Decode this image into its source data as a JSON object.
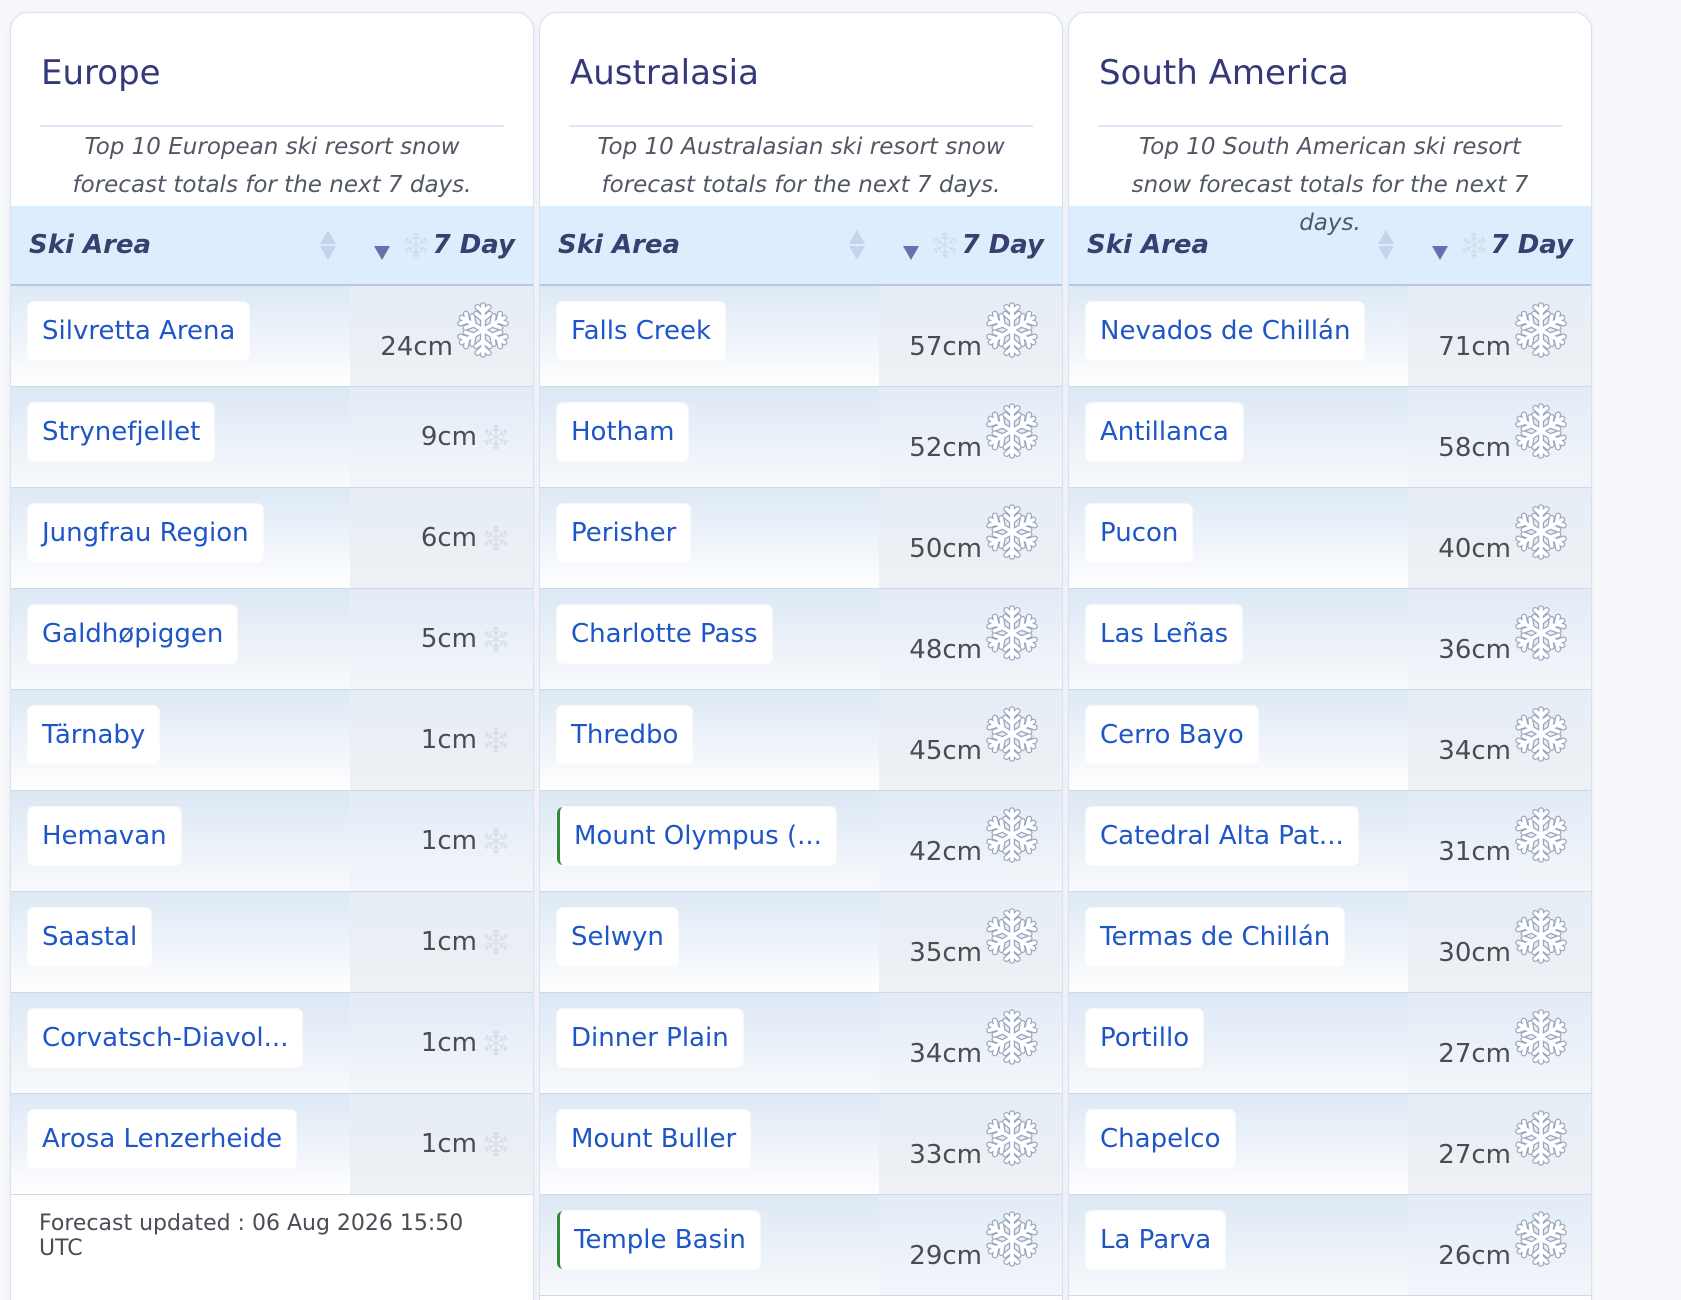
{
  "panels": [
    {
      "title": "Europe",
      "subtitle": "Top 10 European ski resort snow forecast totals for the next 7 days.",
      "col_area": "Ski Area",
      "col_7day": "7 Day",
      "rows": [
        {
          "name": "Silvretta Arena",
          "value": "24cm",
          "flake": "big"
        },
        {
          "name": "Strynefjellet",
          "value": "9cm",
          "flake": "small"
        },
        {
          "name": "Jungfrau Region",
          "value": "6cm",
          "flake": "small"
        },
        {
          "name": "Galdhøpiggen",
          "value": "5cm",
          "flake": "small"
        },
        {
          "name": "Tärnaby",
          "value": "1cm",
          "flake": "small"
        },
        {
          "name": "Hemavan",
          "value": "1cm",
          "flake": "small"
        },
        {
          "name": "Saastal",
          "value": "1cm",
          "flake": "small"
        },
        {
          "name": "Corvatsch-Diavol...",
          "value": "1cm",
          "flake": "small"
        },
        {
          "name": "Arosa Lenzerheide",
          "value": "1cm",
          "flake": "small"
        }
      ],
      "footer": "Forecast updated : 06 Aug 2026 15:50 UTC"
    },
    {
      "title": "Australasia",
      "subtitle": "Top 10 Australasian ski resort snow forecast totals for the next 7 days.",
      "col_area": "Ski Area",
      "col_7day": "7 Day",
      "rows": [
        {
          "name": "Falls Creek",
          "value": "57cm",
          "flake": "big"
        },
        {
          "name": "Hotham",
          "value": "52cm",
          "flake": "big"
        },
        {
          "name": "Perisher",
          "value": "50cm",
          "flake": "big"
        },
        {
          "name": "Charlotte Pass",
          "value": "48cm",
          "flake": "big"
        },
        {
          "name": "Thredbo",
          "value": "45cm",
          "flake": "big"
        },
        {
          "name": "Mount Olympus (...",
          "value": "42cm",
          "flake": "big",
          "marked": true
        },
        {
          "name": "Selwyn",
          "value": "35cm",
          "flake": "big"
        },
        {
          "name": "Dinner Plain",
          "value": "34cm",
          "flake": "big"
        },
        {
          "name": "Mount Buller",
          "value": "33cm",
          "flake": "big"
        },
        {
          "name": "Temple Basin",
          "value": "29cm",
          "flake": "big",
          "marked": true
        }
      ],
      "footer": ""
    },
    {
      "title": "South America",
      "subtitle": "Top 10 South American ski resort snow forecast totals for the next 7 days.",
      "col_area": "Ski Area",
      "col_7day": "7 Day",
      "rows": [
        {
          "name": "Nevados de Chillán",
          "value": "71cm",
          "flake": "big"
        },
        {
          "name": "Antillanca",
          "value": "58cm",
          "flake": "big"
        },
        {
          "name": "Pucon",
          "value": "40cm",
          "flake": "big"
        },
        {
          "name": "Las Leñas",
          "value": "36cm",
          "flake": "big"
        },
        {
          "name": "Cerro Bayo",
          "value": "34cm",
          "flake": "big"
        },
        {
          "name": "Catedral Alta Pat...",
          "value": "31cm",
          "flake": "big"
        },
        {
          "name": "Termas de Chillán",
          "value": "30cm",
          "flake": "big"
        },
        {
          "name": "Portillo",
          "value": "27cm",
          "flake": "big"
        },
        {
          "name": "Chapelco",
          "value": "27cm",
          "flake": "big"
        },
        {
          "name": "La Parva",
          "value": "26cm",
          "flake": "big"
        }
      ],
      "footer": ""
    }
  ],
  "icons": {
    "snowflake": "snowflake-icon",
    "sort": "sort-icon"
  },
  "colors": {
    "title": "#34397a",
    "link": "#1e56c7",
    "header_bg": "#dceefd",
    "marker_green": "#2f8a3a"
  }
}
